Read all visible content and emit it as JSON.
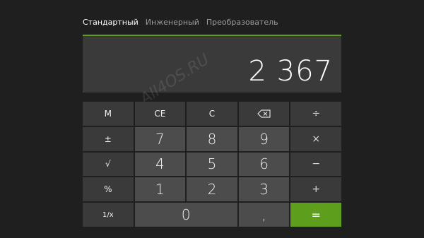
{
  "tabs": [
    {
      "label": "Стандартный",
      "active": true
    },
    {
      "label": "Инженерный",
      "active": false
    },
    {
      "label": "Преобразователь",
      "active": false
    }
  ],
  "display": {
    "value": "2 367"
  },
  "keys": {
    "mem": "M",
    "ce": "CE",
    "c": "C",
    "backspace": "backspace-icon",
    "divide": "÷",
    "plusminus": "±",
    "seven": "7",
    "eight": "8",
    "nine": "9",
    "multiply": "×",
    "sqrt": "√",
    "four": "4",
    "five": "5",
    "six": "6",
    "minus": "−",
    "percent": "%",
    "one": "1",
    "two": "2",
    "three": "3",
    "plus": "+",
    "reciprocal": "1/x",
    "zero": "0",
    "comma": ",",
    "equals": "="
  },
  "watermark": "All4OS.RU",
  "colors": {
    "background": "#1f1f1f",
    "accent": "#5e9e1d",
    "display_bg": "#3a3a3a",
    "digit_key_bg": "#4c4c4c"
  }
}
